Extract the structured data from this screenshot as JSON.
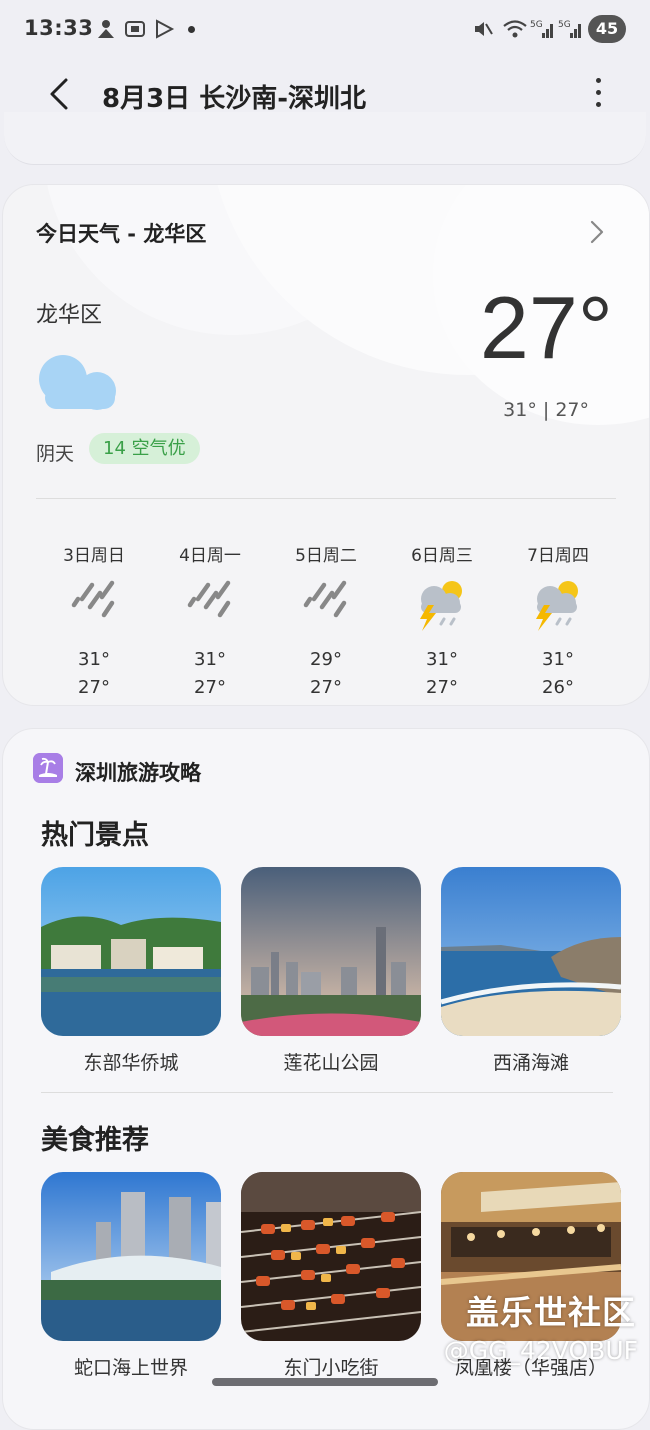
{
  "status_bar": {
    "time": "13:33",
    "battery": "45"
  },
  "header": {
    "title": "8月3日 长沙南-深圳北"
  },
  "weather": {
    "card_title": "今日天气 - 龙华区",
    "location": "龙华区",
    "temperature": "27°",
    "range": "31° | 27°",
    "condition": "阴天",
    "aqi": "14 空气优",
    "forecast": [
      {
        "day": "3日周日",
        "icon": "rain-icon",
        "high": "31°",
        "low": "27°"
      },
      {
        "day": "4日周一",
        "icon": "rain-icon",
        "high": "31°",
        "low": "27°"
      },
      {
        "day": "5日周二",
        "icon": "rain-icon",
        "high": "29°",
        "low": "27°"
      },
      {
        "day": "6日周三",
        "icon": "thunderstorm-icon",
        "high": "31°",
        "low": "27°"
      },
      {
        "day": "7日周四",
        "icon": "thunderstorm-icon",
        "high": "31°",
        "low": "26°"
      }
    ]
  },
  "travel": {
    "title": "深圳旅游攻略",
    "attractions_title": "热门景点",
    "attractions": [
      {
        "name": "东部华侨城"
      },
      {
        "name": "莲花山公园"
      },
      {
        "name": "西涌海滩"
      }
    ],
    "food_title": "美食推荐",
    "food": [
      {
        "name": "蛇口海上世界"
      },
      {
        "name": "东门小吃街"
      },
      {
        "name": "凤凰楼（华强店）"
      }
    ]
  },
  "watermark": {
    "line1": "盖乐世社区",
    "line2": "@GG_42VOBUF"
  },
  "colors": {
    "aqi_bg": "#d6f0d8",
    "aqi_text": "#3aa048",
    "lightning": "#f5b800",
    "accent_purple": "#a87ee6"
  }
}
